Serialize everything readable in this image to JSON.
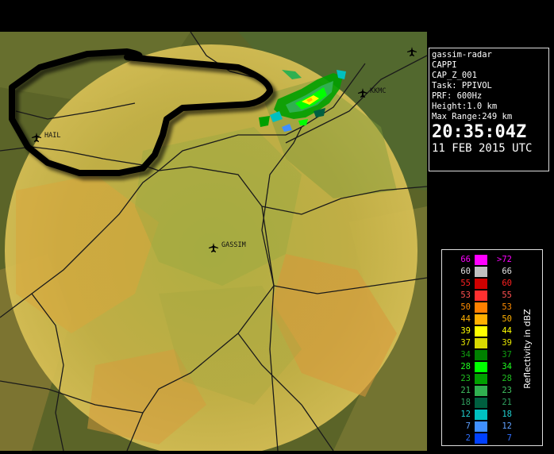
{
  "info": {
    "radar_name": "gassim-radar",
    "product": "CAPPI",
    "product_id": "CAP_Z_001",
    "task": "Task: PPIVOL",
    "prf": "PRF: 600Hz",
    "height": "Height:1.0 km",
    "max_range": "Max Range:249 km",
    "time": "20:35:04Z",
    "date": "11 FEB 2015 UTC"
  },
  "legend": {
    "title": "Reflectivity in dBZ",
    "rows": [
      {
        "left": "66",
        "right": ">72",
        "color": "#ff00ff",
        "text_color": "#ff00ff"
      },
      {
        "left": "60",
        "right": "66",
        "color": "#c0c0c0",
        "text_color": "#e0e0e0"
      },
      {
        "left": "55",
        "right": "60",
        "color": "#d00000",
        "text_color": "#ff2020"
      },
      {
        "left": "53",
        "right": "55",
        "color": "#ff3030",
        "text_color": "#ff5050"
      },
      {
        "left": "50",
        "right": "53",
        "color": "#ff8000",
        "text_color": "#ff8c00"
      },
      {
        "left": "44",
        "right": "50",
        "color": "#ffb000",
        "text_color": "#ffb000"
      },
      {
        "left": "39",
        "right": "44",
        "color": "#ffff00",
        "text_color": "#ffff00"
      },
      {
        "left": "37",
        "right": "39",
        "color": "#d8d800",
        "text_color": "#e6e600"
      },
      {
        "left": "34",
        "right": "37",
        "color": "#008000",
        "text_color": "#10a010"
      },
      {
        "left": "28",
        "right": "34",
        "color": "#00ff00",
        "text_color": "#20ff20"
      },
      {
        "left": "23",
        "right": "28",
        "color": "#00a000",
        "text_color": "#20c020"
      },
      {
        "left": "21",
        "right": "23",
        "color": "#30b050",
        "text_color": "#40c060"
      },
      {
        "left": "18",
        "right": "21",
        "color": "#006040",
        "text_color": "#30a060"
      },
      {
        "left": "12",
        "right": "18",
        "color": "#00c0c0",
        "text_color": "#20d0d0"
      },
      {
        "left": "7",
        "right": "12",
        "color": "#4090ff",
        "text_color": "#60a0ff"
      },
      {
        "left": "2",
        "right": "7",
        "color": "#0040ff",
        "text_color": "#3070ff"
      }
    ]
  },
  "map": {
    "cities": [
      {
        "name": "HAIL"
      },
      {
        "name": "KKMC"
      },
      {
        "name": "GASSIM"
      }
    ],
    "colors": {
      "terrain_dark": "#4e5a1f",
      "range_circle": "#d8cc4a",
      "roads": "#1a1a1a",
      "outline": "#000000"
    }
  }
}
